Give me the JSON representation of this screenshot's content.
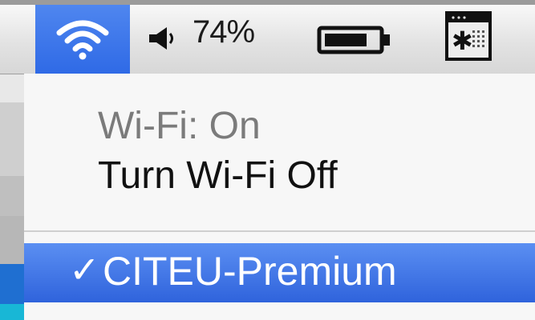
{
  "menubar": {
    "battery_percent": "74%",
    "icons": {
      "wifi": "wifi-icon",
      "volume": "volume-icon",
      "battery": "battery-icon",
      "calendar": "calendar-icon"
    },
    "accent_color": "#2f6ae6"
  },
  "wifi_menu": {
    "status": "Wi-Fi: On",
    "toggle_label": "Turn Wi-Fi Off",
    "networks": [
      {
        "name": "CITEU-Premium",
        "selected": true,
        "check": "✓"
      }
    ]
  }
}
